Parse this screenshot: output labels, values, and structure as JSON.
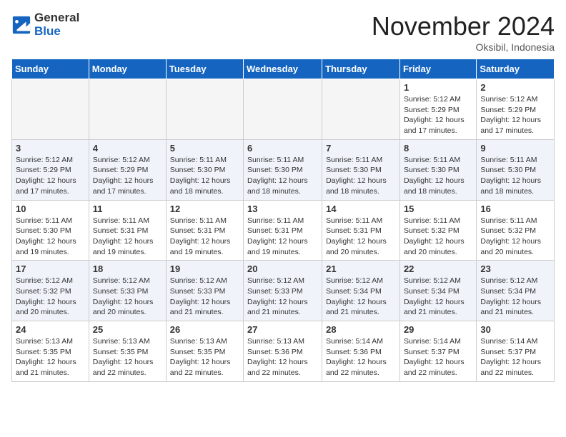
{
  "header": {
    "logo_general": "General",
    "logo_blue": "Blue",
    "month_title": "November 2024",
    "location": "Oksibil, Indonesia"
  },
  "days_of_week": [
    "Sunday",
    "Monday",
    "Tuesday",
    "Wednesday",
    "Thursday",
    "Friday",
    "Saturday"
  ],
  "weeks": [
    {
      "shade": false,
      "days": [
        {
          "num": "",
          "info": ""
        },
        {
          "num": "",
          "info": ""
        },
        {
          "num": "",
          "info": ""
        },
        {
          "num": "",
          "info": ""
        },
        {
          "num": "",
          "info": ""
        },
        {
          "num": "1",
          "info": "Sunrise: 5:12 AM\nSunset: 5:29 PM\nDaylight: 12 hours\nand 17 minutes."
        },
        {
          "num": "2",
          "info": "Sunrise: 5:12 AM\nSunset: 5:29 PM\nDaylight: 12 hours\nand 17 minutes."
        }
      ]
    },
    {
      "shade": true,
      "days": [
        {
          "num": "3",
          "info": "Sunrise: 5:12 AM\nSunset: 5:29 PM\nDaylight: 12 hours\nand 17 minutes."
        },
        {
          "num": "4",
          "info": "Sunrise: 5:12 AM\nSunset: 5:29 PM\nDaylight: 12 hours\nand 17 minutes."
        },
        {
          "num": "5",
          "info": "Sunrise: 5:11 AM\nSunset: 5:30 PM\nDaylight: 12 hours\nand 18 minutes."
        },
        {
          "num": "6",
          "info": "Sunrise: 5:11 AM\nSunset: 5:30 PM\nDaylight: 12 hours\nand 18 minutes."
        },
        {
          "num": "7",
          "info": "Sunrise: 5:11 AM\nSunset: 5:30 PM\nDaylight: 12 hours\nand 18 minutes."
        },
        {
          "num": "8",
          "info": "Sunrise: 5:11 AM\nSunset: 5:30 PM\nDaylight: 12 hours\nand 18 minutes."
        },
        {
          "num": "9",
          "info": "Sunrise: 5:11 AM\nSunset: 5:30 PM\nDaylight: 12 hours\nand 18 minutes."
        }
      ]
    },
    {
      "shade": false,
      "days": [
        {
          "num": "10",
          "info": "Sunrise: 5:11 AM\nSunset: 5:30 PM\nDaylight: 12 hours\nand 19 minutes."
        },
        {
          "num": "11",
          "info": "Sunrise: 5:11 AM\nSunset: 5:31 PM\nDaylight: 12 hours\nand 19 minutes."
        },
        {
          "num": "12",
          "info": "Sunrise: 5:11 AM\nSunset: 5:31 PM\nDaylight: 12 hours\nand 19 minutes."
        },
        {
          "num": "13",
          "info": "Sunrise: 5:11 AM\nSunset: 5:31 PM\nDaylight: 12 hours\nand 19 minutes."
        },
        {
          "num": "14",
          "info": "Sunrise: 5:11 AM\nSunset: 5:31 PM\nDaylight: 12 hours\nand 20 minutes."
        },
        {
          "num": "15",
          "info": "Sunrise: 5:11 AM\nSunset: 5:32 PM\nDaylight: 12 hours\nand 20 minutes."
        },
        {
          "num": "16",
          "info": "Sunrise: 5:11 AM\nSunset: 5:32 PM\nDaylight: 12 hours\nand 20 minutes."
        }
      ]
    },
    {
      "shade": true,
      "days": [
        {
          "num": "17",
          "info": "Sunrise: 5:12 AM\nSunset: 5:32 PM\nDaylight: 12 hours\nand 20 minutes."
        },
        {
          "num": "18",
          "info": "Sunrise: 5:12 AM\nSunset: 5:33 PM\nDaylight: 12 hours\nand 20 minutes."
        },
        {
          "num": "19",
          "info": "Sunrise: 5:12 AM\nSunset: 5:33 PM\nDaylight: 12 hours\nand 21 minutes."
        },
        {
          "num": "20",
          "info": "Sunrise: 5:12 AM\nSunset: 5:33 PM\nDaylight: 12 hours\nand 21 minutes."
        },
        {
          "num": "21",
          "info": "Sunrise: 5:12 AM\nSunset: 5:34 PM\nDaylight: 12 hours\nand 21 minutes."
        },
        {
          "num": "22",
          "info": "Sunrise: 5:12 AM\nSunset: 5:34 PM\nDaylight: 12 hours\nand 21 minutes."
        },
        {
          "num": "23",
          "info": "Sunrise: 5:12 AM\nSunset: 5:34 PM\nDaylight: 12 hours\nand 21 minutes."
        }
      ]
    },
    {
      "shade": false,
      "days": [
        {
          "num": "24",
          "info": "Sunrise: 5:13 AM\nSunset: 5:35 PM\nDaylight: 12 hours\nand 21 minutes."
        },
        {
          "num": "25",
          "info": "Sunrise: 5:13 AM\nSunset: 5:35 PM\nDaylight: 12 hours\nand 22 minutes."
        },
        {
          "num": "26",
          "info": "Sunrise: 5:13 AM\nSunset: 5:35 PM\nDaylight: 12 hours\nand 22 minutes."
        },
        {
          "num": "27",
          "info": "Sunrise: 5:13 AM\nSunset: 5:36 PM\nDaylight: 12 hours\nand 22 minutes."
        },
        {
          "num": "28",
          "info": "Sunrise: 5:14 AM\nSunset: 5:36 PM\nDaylight: 12 hours\nand 22 minutes."
        },
        {
          "num": "29",
          "info": "Sunrise: 5:14 AM\nSunset: 5:37 PM\nDaylight: 12 hours\nand 22 minutes."
        },
        {
          "num": "30",
          "info": "Sunrise: 5:14 AM\nSunset: 5:37 PM\nDaylight: 12 hours\nand 22 minutes."
        }
      ]
    }
  ]
}
